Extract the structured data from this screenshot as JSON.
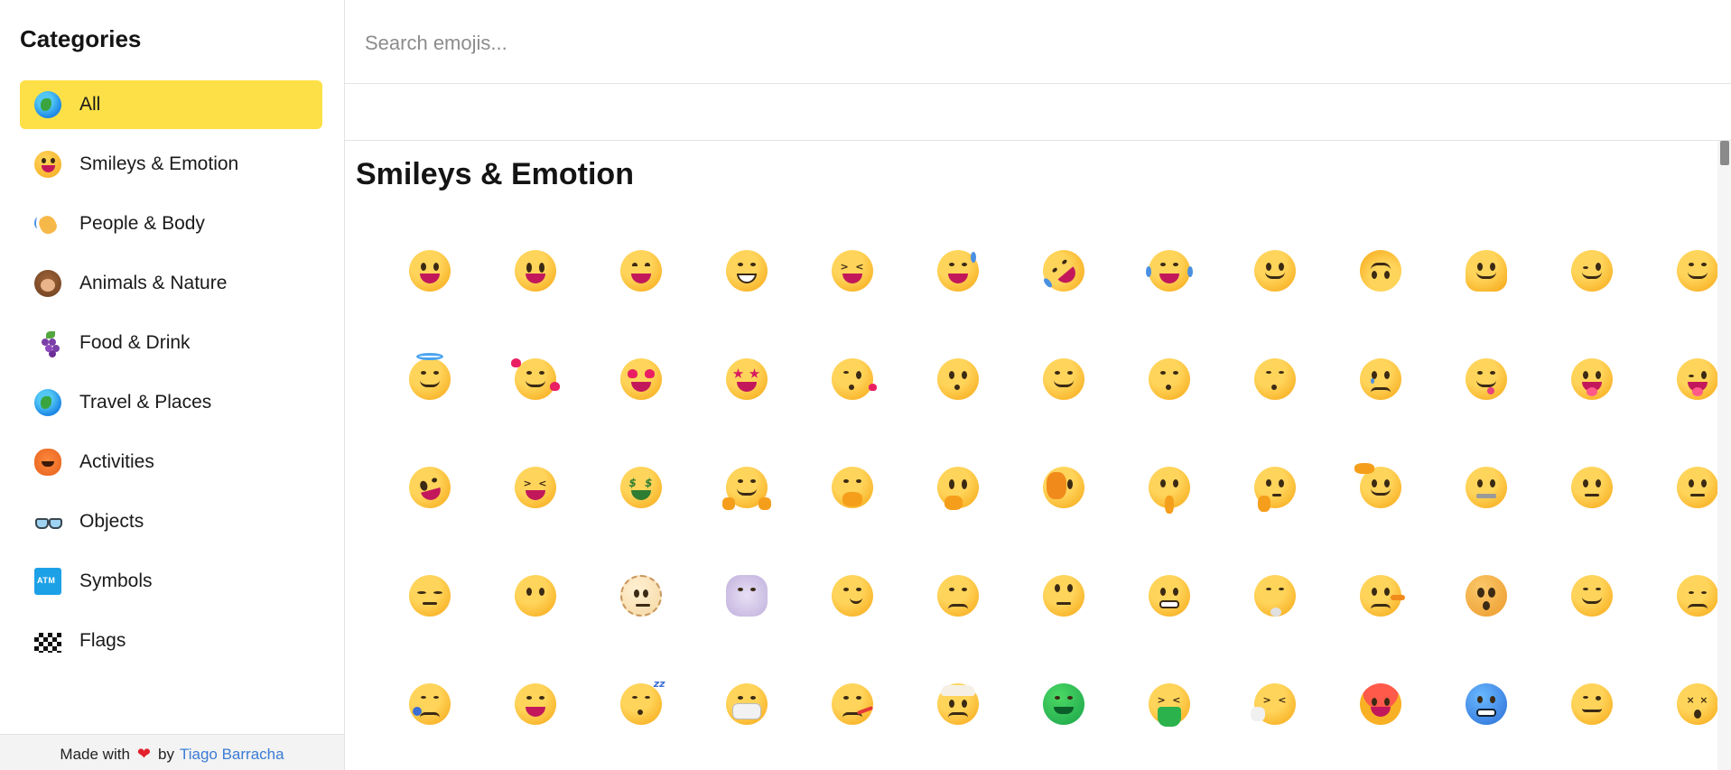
{
  "sidebar": {
    "title": "Categories",
    "items": [
      {
        "label": "All",
        "icon": "globe-icon",
        "active": true
      },
      {
        "label": "Smileys & Emotion",
        "icon": "smiley-icon",
        "active": false
      },
      {
        "label": "People & Body",
        "icon": "waving-hand-icon",
        "active": false
      },
      {
        "label": "Animals & Nature",
        "icon": "monkey-icon",
        "active": false
      },
      {
        "label": "Food & Drink",
        "icon": "grapes-icon",
        "active": false
      },
      {
        "label": "Travel & Places",
        "icon": "globe-icon",
        "active": false
      },
      {
        "label": "Activities",
        "icon": "jack-o-lantern-icon",
        "active": false
      },
      {
        "label": "Objects",
        "icon": "glasses-icon",
        "active": false
      },
      {
        "label": "Symbols",
        "icon": "atm-icon",
        "active": false
      },
      {
        "label": "Flags",
        "icon": "checkered-flag-icon",
        "active": false
      }
    ],
    "footer": {
      "made_with": "Made with",
      "by": "by",
      "author": "Tiago Barracha"
    }
  },
  "search": {
    "placeholder": "Search emojis...",
    "value": ""
  },
  "section": {
    "title": "Smileys & Emotion"
  },
  "colors": {
    "active_category": "#fde047",
    "link": "#3a7bd5",
    "heart": "#e3202b"
  },
  "emojis": [
    "grinning-face-icon",
    "grinning-face-big-eyes-icon",
    "grinning-face-smiling-eyes-icon",
    "beaming-face-icon",
    "grinning-squinting-face-icon",
    "grinning-sweat-icon",
    "rolling-on-floor-laughing-icon",
    "tears-of-joy-icon",
    "slightly-smiling-face-icon",
    "upside-down-face-icon",
    "melting-face-icon",
    "winking-face-icon",
    "smiling-eyes-face-icon",
    "halo-face-icon",
    "smiling-hearts-icon",
    "heart-eyes-icon",
    "star-struck-icon",
    "blowing-kiss-icon",
    "kissing-face-icon",
    "smiling-face-icon",
    "kissing-closed-eyes-icon",
    "kissing-smiling-eyes-icon",
    "holding-back-tears-icon",
    "savoring-food-icon",
    "tongue-face-icon",
    "winking-tongue-icon",
    "zany-face-icon",
    "squinting-tongue-icon",
    "money-mouth-icon",
    "hugging-face-icon",
    "hand-over-mouth-icon",
    "open-eyes-hand-over-mouth-icon",
    "peeking-eye-icon",
    "shushing-face-icon",
    "thinking-face-icon",
    "saluting-face-icon",
    "zipper-mouth-icon",
    "raised-eyebrow-icon",
    "neutral-face-icon",
    "expressionless-face-icon",
    "no-mouth-face-icon",
    "dotted-line-face-icon",
    "face-in-clouds-icon",
    "smirking-face-icon",
    "unamused-face-icon",
    "rolling-eyes-icon",
    "grimacing-face-icon",
    "exhaling-face-icon",
    "lying-face-icon",
    "shaking-face-icon",
    "relieved-face-icon",
    "pensive-face-icon",
    "sleepy-face-icon",
    "drooling-face-icon",
    "sleeping-face-icon",
    "medical-mask-icon",
    "thermometer-face-icon",
    "head-bandage-icon",
    "nauseated-face-icon",
    "vomiting-face-icon",
    "sneezing-face-icon",
    "hot-face-icon",
    "cold-face-icon",
    "woozy-face-icon",
    "crossed-out-eyes-icon"
  ]
}
